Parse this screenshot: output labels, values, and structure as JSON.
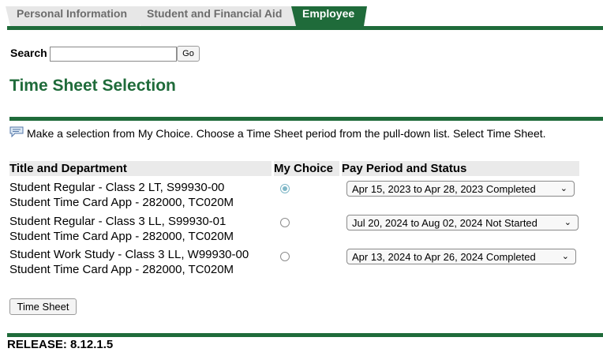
{
  "tabs": [
    {
      "label": "Personal Information",
      "active": false
    },
    {
      "label": "Student and Financial Aid",
      "active": false
    },
    {
      "label": "Employee",
      "active": true
    }
  ],
  "search": {
    "label": "Search",
    "value": "",
    "button": "Go"
  },
  "page_title": "Time Sheet Selection",
  "info_message": "Make a selection from My Choice. Choose a Time Sheet period from the pull-down list. Select Time Sheet.",
  "table": {
    "headers": [
      "Title and Department",
      "My Choice",
      "Pay Period and Status"
    ],
    "rows": [
      {
        "title": "Student Regular - Class 2 LT, S99930-00",
        "department": "Student Time Card App - 282000, TC020M",
        "selected": true,
        "period": "Apr 15, 2023 to Apr 28, 2023 Completed"
      },
      {
        "title": "Student Regular - Class 3 LL, S99930-01",
        "department": "Student Time Card App - 282000, TC020M",
        "selected": false,
        "period": "Jul 20, 2024 to Aug 02, 2024 Not Started"
      },
      {
        "title": "Student Work Study - Class 3 LL, W99930-00",
        "department": "Student Time Card App - 282000, TC020M",
        "selected": false,
        "period": "Apr 13, 2024 to Apr 26, 2024 Completed"
      }
    ]
  },
  "time_sheet_button": "Time Sheet",
  "release": "RELEASE: 8.12.1.5",
  "colors": {
    "accent": "#1f6b3a",
    "header_bg": "#eaeaea"
  }
}
